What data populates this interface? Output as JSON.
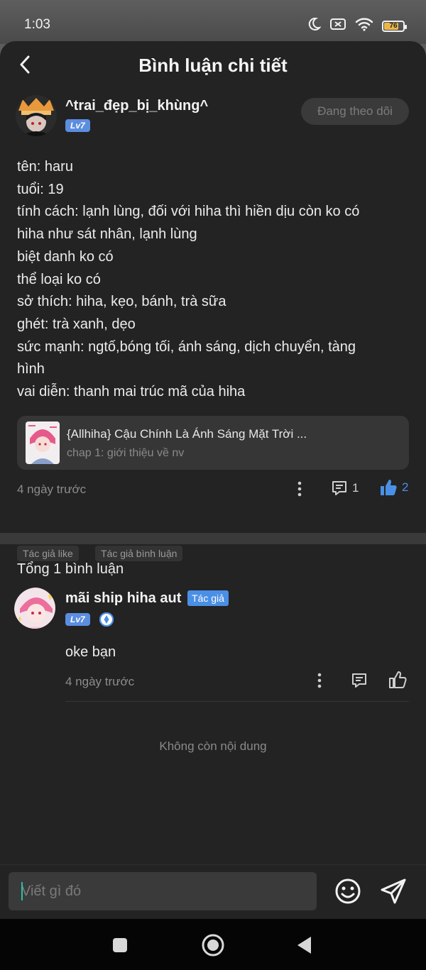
{
  "status_bar": {
    "time": "1:03",
    "battery": "76",
    "icons": [
      "moon-icon",
      "sim-off-icon",
      "wifi-icon",
      "battery-icon"
    ]
  },
  "header": {
    "title": "Bình luận chi tiết"
  },
  "post": {
    "author": {
      "name": "^trai_đẹp_bị_khùng^",
      "level": "Lv7"
    },
    "follow_label": "Đang theo dõi",
    "body_lines": [
      "tên: haru",
      "tuổi: 19",
      "tính cách: lạnh lùng, đối với hiha thì hiền dịu còn ko có",
      "hiha như sát nhân, lạnh lùng",
      "biệt danh ko có",
      "thể loại ko có",
      "sở thích: hiha, kẹo, bánh, trà sữa",
      "ghét: trà xanh, dẹo",
      "sức mạnh: ngtố,bóng tối, ánh sáng, dịch chuyển, tàng",
      "hình",
      "vai diễn: thanh mai trúc mã của hiha"
    ],
    "story": {
      "title": "{Allhiha} Cậu Chính Là Ánh Sáng Mặt Trời ...",
      "chapter": "chap 1: giới thiệu về nv"
    },
    "time": "4 ngày trước",
    "comment_count": "1",
    "like_count": "2",
    "tags": [
      "Tác giả like",
      "Tác giả bình luận"
    ]
  },
  "comments": {
    "total_label": "Tổng 1 bình luận",
    "items": [
      {
        "name": "mãi ship hiha aut",
        "author_tag": "Tác giả",
        "level": "Lv7",
        "text": "oke bạn",
        "time": "4 ngày trước"
      }
    ],
    "end_label": "Không còn nội dung"
  },
  "composer": {
    "placeholder": "Viết gì đó"
  },
  "colors": {
    "accent_blue": "#4a90e8",
    "background": "#232323",
    "caret": "#2bbfa4"
  }
}
